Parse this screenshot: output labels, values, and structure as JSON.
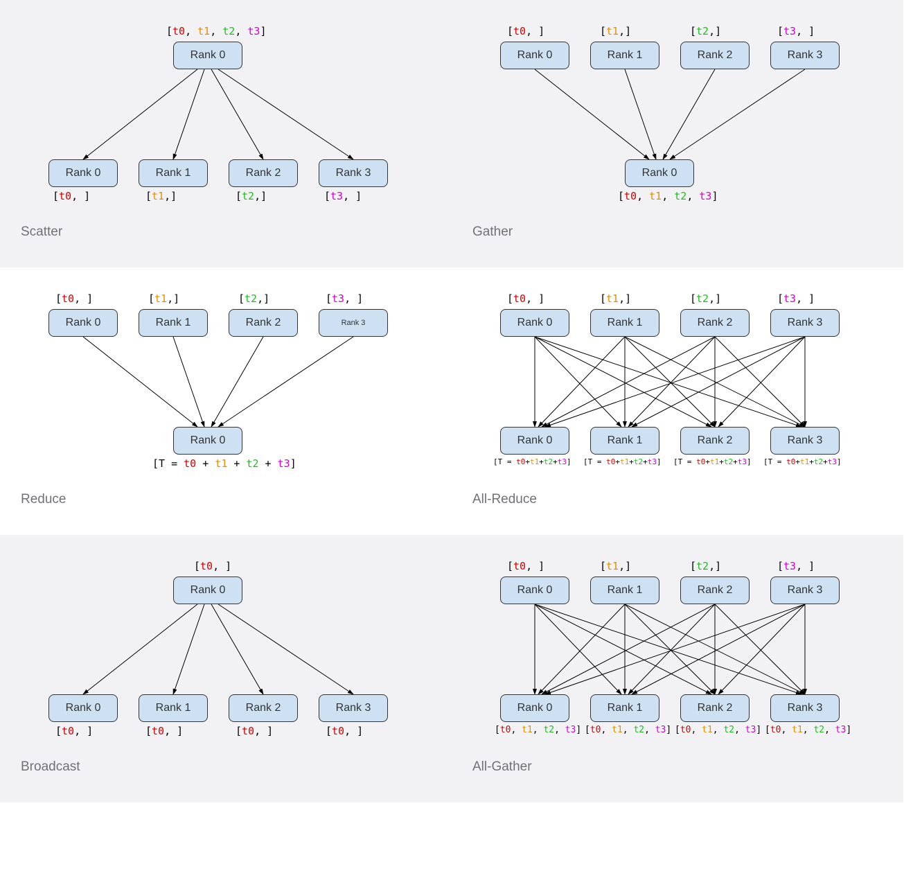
{
  "tensor_colors": [
    "#d40000",
    "#e09000",
    "#1dbf1d",
    "#d400d4"
  ],
  "tensor_names": [
    "t0",
    "t1",
    "t2",
    "t3"
  ],
  "panels": {
    "scatter": {
      "caption": "Scatter",
      "top_single_rank": "Rank 0",
      "top_single_data": [
        "t0",
        "t1",
        "t2",
        "t3"
      ],
      "bottom_ranks": [
        "Rank 0",
        "Rank 1",
        "Rank 2",
        "Rank 3"
      ],
      "bottom_data": [
        [
          "t0"
        ],
        [
          "t1"
        ],
        [
          "t2"
        ],
        [
          "t3"
        ]
      ]
    },
    "gather": {
      "caption": "Gather",
      "top_ranks": [
        "Rank 0",
        "Rank 1",
        "Rank 2",
        "Rank 3"
      ],
      "top_data": [
        [
          "t0"
        ],
        [
          "t1"
        ],
        [
          "t2"
        ],
        [
          "t3"
        ]
      ],
      "bottom_single_rank": "Rank 0",
      "bottom_single_data": [
        "t0",
        "t1",
        "t2",
        "t3"
      ]
    },
    "reduce": {
      "caption": "Reduce",
      "top_ranks": [
        "Rank 0",
        "Rank 1",
        "Rank 2",
        "Rank 3"
      ],
      "top_data": [
        [
          "t0"
        ],
        [
          "t1"
        ],
        [
          "t2"
        ],
        [
          "t3"
        ]
      ],
      "bottom_single_rank": "Rank 0",
      "bottom_formula_prefix": "[T = ",
      "bottom_formula_terms": [
        "t0",
        "t1",
        "t2",
        "t3"
      ],
      "bottom_formula_join": " + ",
      "bottom_formula_suffix": "]"
    },
    "allreduce": {
      "caption": "All-Reduce",
      "top_ranks": [
        "Rank 0",
        "Rank 1",
        "Rank 2",
        "Rank 3"
      ],
      "top_data": [
        [
          "t0"
        ],
        [
          "t1"
        ],
        [
          "t2"
        ],
        [
          "t3"
        ]
      ],
      "bottom_ranks": [
        "Rank 0",
        "Rank 1",
        "Rank 2",
        "Rank 3"
      ],
      "bottom_formula_prefix": "[T = ",
      "bottom_formula_terms": [
        "t0",
        "t1",
        "t2",
        "t3"
      ],
      "bottom_formula_join": "+",
      "bottom_formula_suffix": "]"
    },
    "broadcast": {
      "caption": "Broadcast",
      "top_single_rank": "Rank 0",
      "top_single_data": [
        "t0"
      ],
      "bottom_ranks": [
        "Rank 0",
        "Rank 1",
        "Rank 2",
        "Rank 3"
      ],
      "bottom_data": [
        [
          "t0"
        ],
        [
          "t0"
        ],
        [
          "t0"
        ],
        [
          "t0"
        ]
      ]
    },
    "allgather": {
      "caption": "All-Gather",
      "top_ranks": [
        "Rank 0",
        "Rank 1",
        "Rank 2",
        "Rank 3"
      ],
      "top_data": [
        [
          "t0"
        ],
        [
          "t1"
        ],
        [
          "t2"
        ],
        [
          "t3"
        ]
      ],
      "bottom_ranks": [
        "Rank 0",
        "Rank 1",
        "Rank 2",
        "Rank 3"
      ],
      "bottom_data": [
        [
          "t0",
          "t1",
          "t2",
          "t3"
        ],
        [
          "t0",
          "t1",
          "t2",
          "t3"
        ],
        [
          "t0",
          "t1",
          "t2",
          "t3"
        ],
        [
          "t0",
          "t1",
          "t2",
          "t3"
        ]
      ]
    }
  }
}
